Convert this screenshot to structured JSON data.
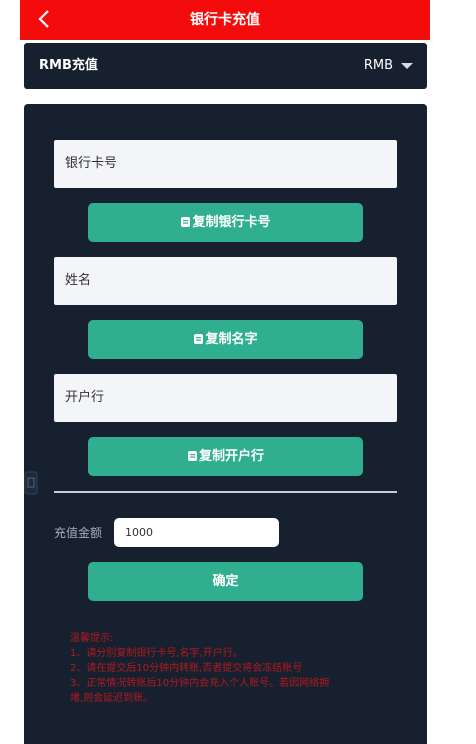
{
  "header": {
    "title": "银行卡充值",
    "back_icon": "chevron-left-icon",
    "background": "#f40c0c"
  },
  "currency": {
    "label": "RMB充值",
    "selected": "RMB"
  },
  "form": {
    "bank_card_placeholder": "银行卡号",
    "copy_bank_card": "复制银行卡号",
    "name_placeholder": "姓名",
    "copy_name": "复制名字",
    "bank_branch_placeholder": "开户行",
    "copy_branch": "复制开户行",
    "copy_icon": "copy-icon",
    "amount_label": "充值金额",
    "amount_value": "1000",
    "confirm_label": "确定",
    "accent": "#2fae90"
  },
  "tips": {
    "title": "温馨提示:",
    "lines": [
      "1、请分别复制银行卡号,名字,开户行。",
      "2、请在提交后10分钟内转账,否者提交将会冻结账号",
      "3、正常情况转账后10分钟内会充入个人账号。若因网络拥",
      "堵,则会延迟到账。"
    ],
    "color": "#b21a1e"
  },
  "theme": {
    "panel": "#17202f"
  }
}
